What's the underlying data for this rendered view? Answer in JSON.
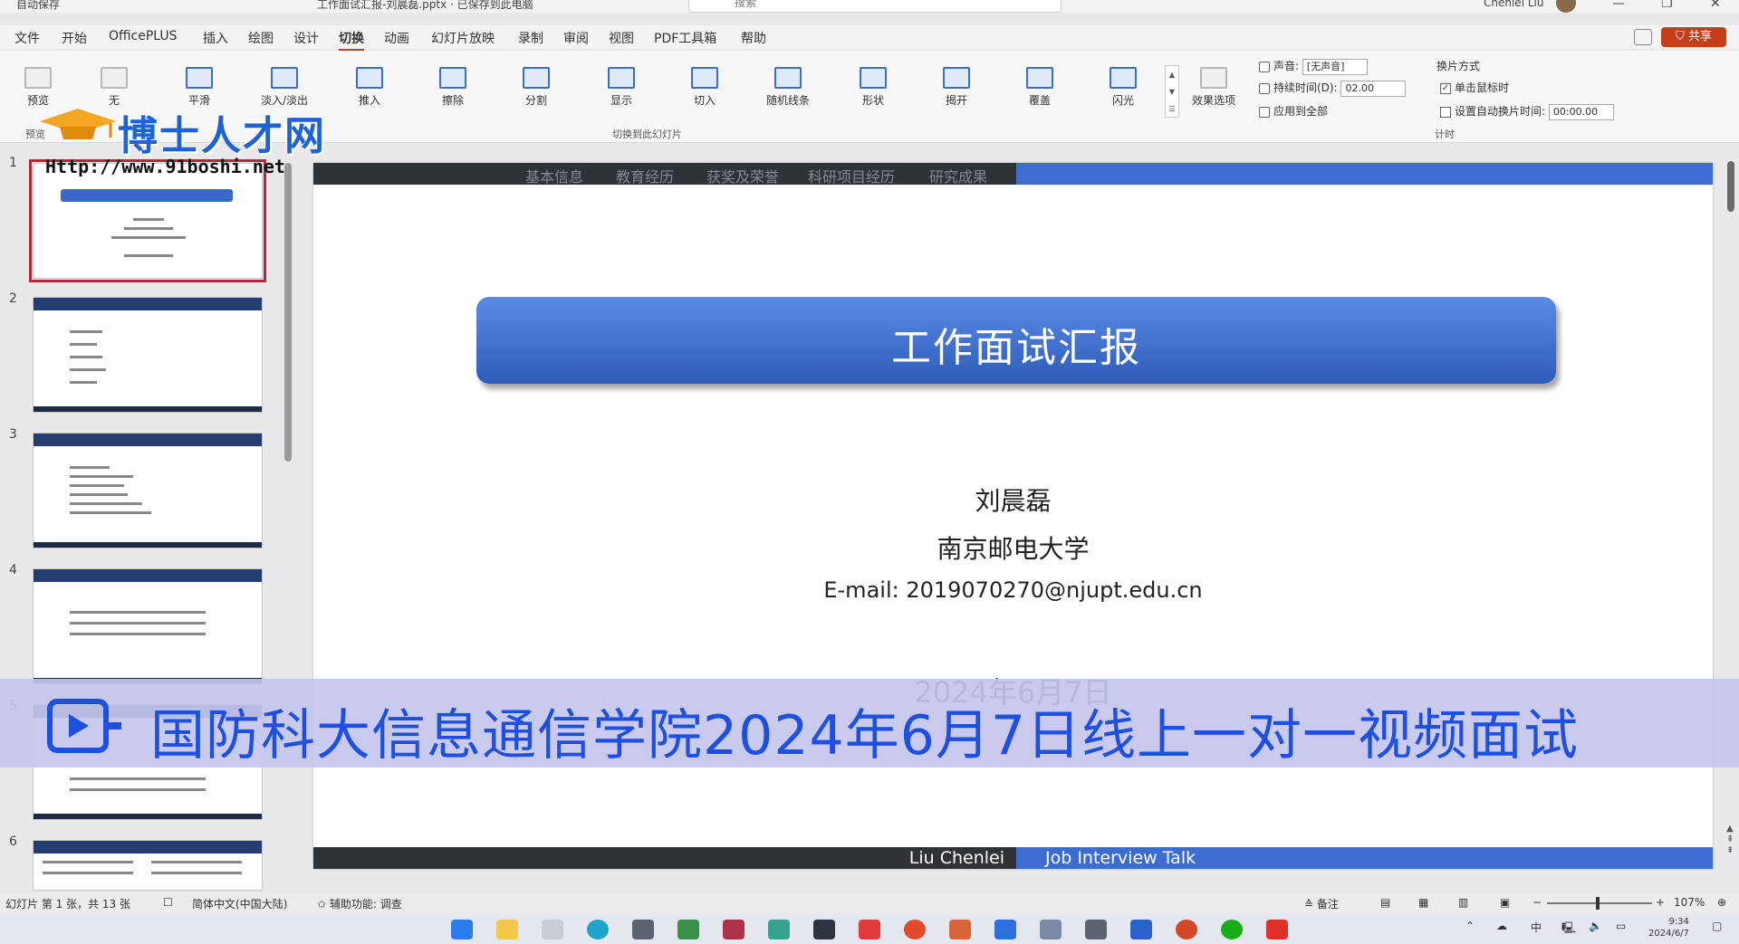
{
  "titlebar": {
    "autosave": "自动保存",
    "title": "工作面试汇报-刘晨磊.pptx · 已保存到此电脑",
    "search_placeholder": "搜索",
    "user": "Chenlei Liu"
  },
  "menu": {
    "tabs": [
      "文件",
      "开始",
      "OfficePLUS",
      "插入",
      "绘图",
      "设计",
      "切换",
      "动画",
      "幻灯片放映",
      "录制",
      "审阅",
      "视图",
      "PDF工具箱",
      "帮助"
    ],
    "active": "切换",
    "share": "共享"
  },
  "ribbon": {
    "preview": "预览",
    "preview_group": "预览",
    "transitions": [
      "无",
      "平滑",
      "淡入/淡出",
      "推入",
      "擦除",
      "分割",
      "显示",
      "切入",
      "随机线条",
      "形状",
      "揭开",
      "覆盖",
      "闪光"
    ],
    "effect_options": "效果选项",
    "group_label": "切换到此幻灯片",
    "sound_label": "声音:",
    "sound_value": "[无声音]",
    "duration_label": "持续时间(D):",
    "duration_value": "02.00",
    "apply_all": "应用到全部",
    "advance_label": "换片方式",
    "on_click": "单击鼠标时",
    "after_label": "设置自动换片时间:",
    "after_value": "00:00.00",
    "timing_group": "计时"
  },
  "logo": {
    "text": "博士人才网",
    "url": "Http://www.91boshi.net"
  },
  "thumbnails": {
    "numbers": [
      "1",
      "2",
      "3",
      "4",
      "5",
      "6"
    ],
    "selected": 1
  },
  "slide": {
    "nav_items": [
      "基本信息",
      "教育经历",
      "获奖及荣誉",
      "科研项目经历",
      "研究成果"
    ],
    "title": "工作面试汇报",
    "name": "刘晨磊",
    "university": "南京邮电大学",
    "email": "E-mail: 2019070270@njupt.edu.cn",
    "date": "2024年6月7日",
    "footer_name": "Liu Chenlei",
    "footer_title": "Job Interview Talk"
  },
  "banner": {
    "caption": "国防科大信息通信学院2024年6月7日线上一对一视频面试"
  },
  "status": {
    "slide_count": "幻灯片 第 1 张，共 13 张",
    "language": "简体中文(中国大陆)",
    "accessibility": "辅助功能: 调查",
    "notes": "备注",
    "zoom": "107%"
  },
  "taskbar": {
    "time": "9:34",
    "date": "2024/6/7",
    "ime": "中"
  },
  "colors": {
    "accent": "#c43e1c",
    "slide_blue": "#3b6dd0",
    "slide_dark": "#2f3236",
    "banner_text": "#1d4fe0",
    "logo_blue": "#1d63d6"
  }
}
